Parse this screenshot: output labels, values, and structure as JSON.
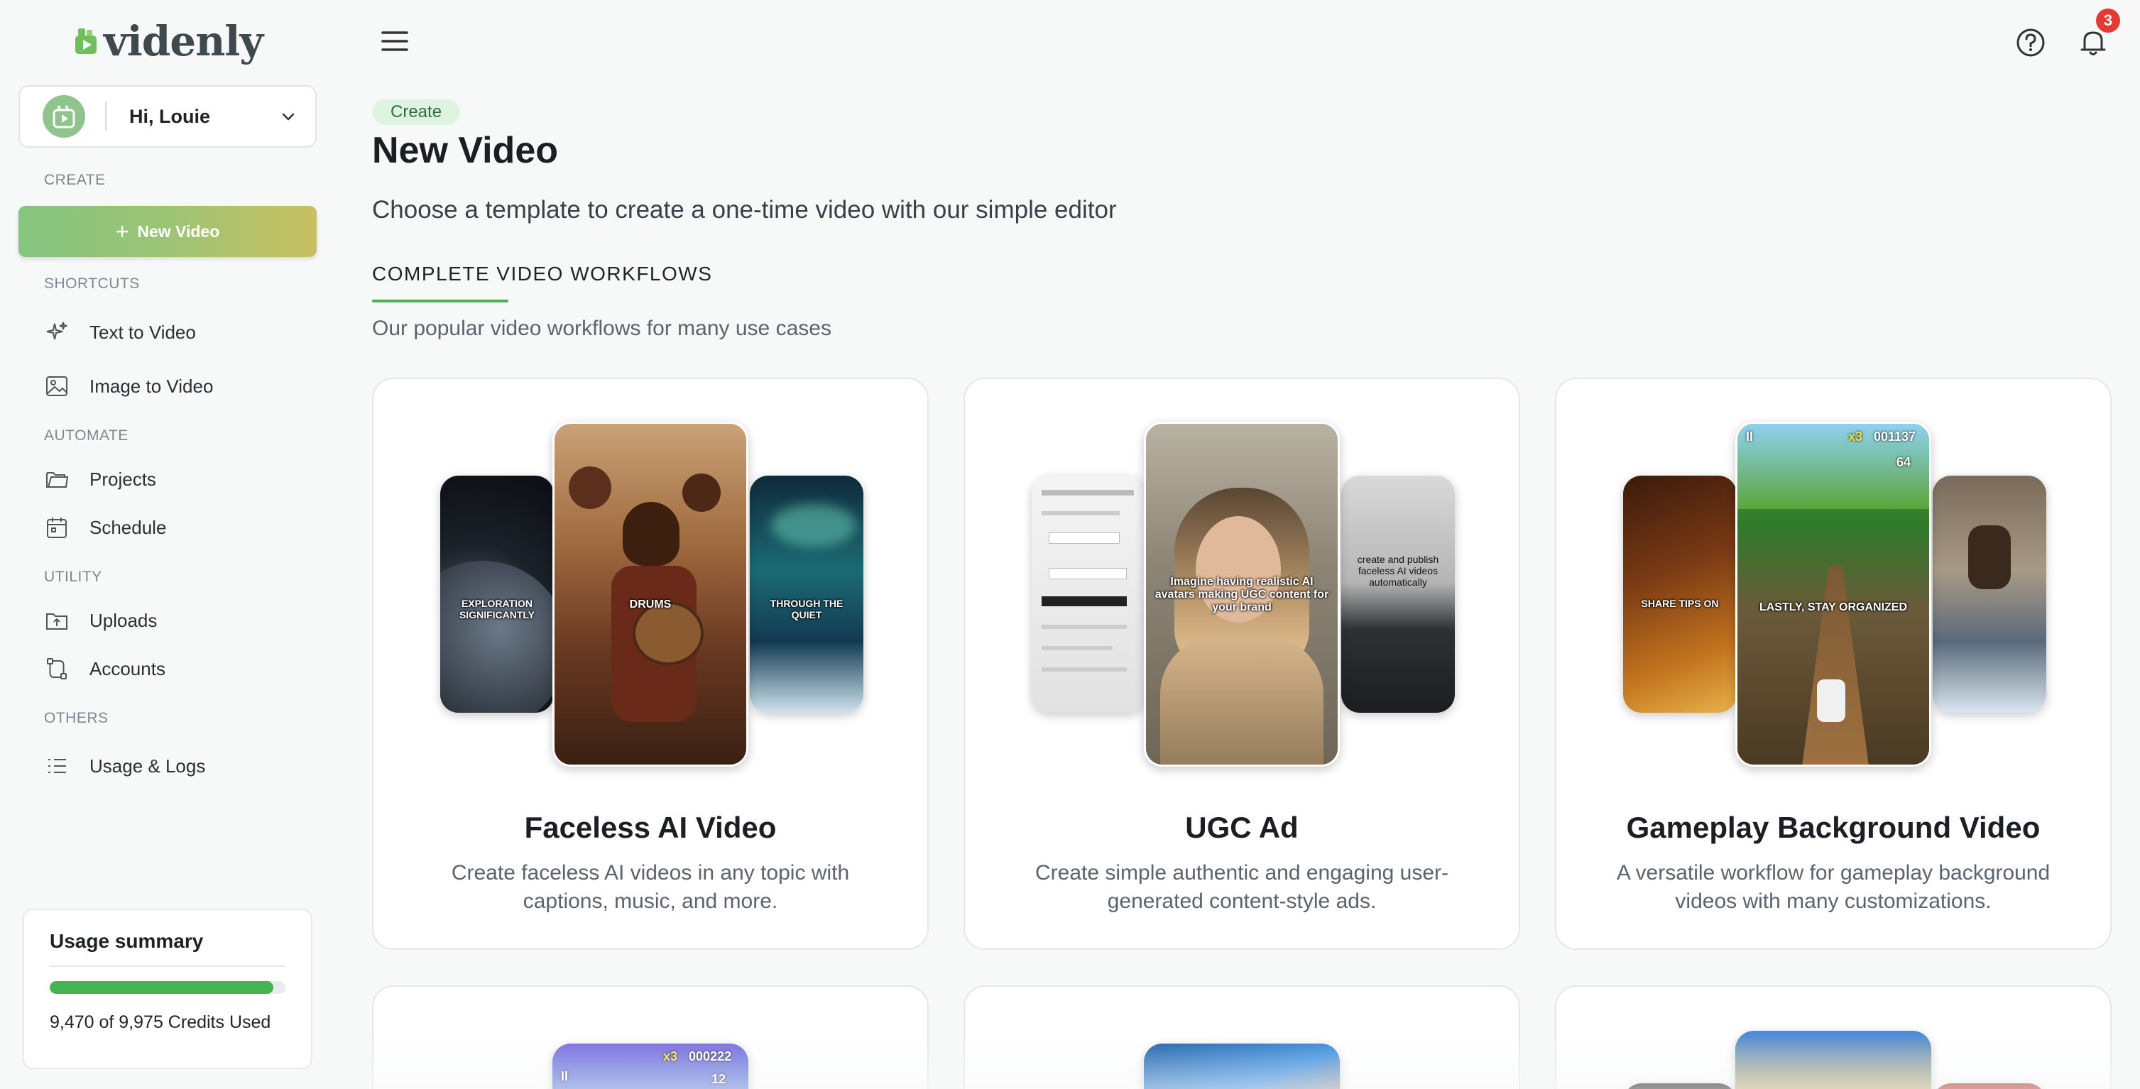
{
  "brand": {
    "name": "videnly",
    "accent": "#4cb05a"
  },
  "user": {
    "greeting": "Hi, Louie"
  },
  "sidebar": {
    "sections": {
      "create": "CREATE",
      "shortcuts": "SHORTCUTS",
      "automate": "AUTOMATE",
      "utility": "UTILITY",
      "others": "OTHERS"
    },
    "new_video_label": "New Video",
    "items": [
      {
        "label": "Text to Video",
        "icon": "sparkle-icon"
      },
      {
        "label": "Image to Video",
        "icon": "image-icon"
      },
      {
        "label": "Projects",
        "icon": "folder-icon"
      },
      {
        "label": "Schedule",
        "icon": "calendar-icon"
      },
      {
        "label": "Uploads",
        "icon": "upload-icon"
      },
      {
        "label": "Accounts",
        "icon": "accounts-icon"
      },
      {
        "label": "Usage & Logs",
        "icon": "list-icon"
      }
    ]
  },
  "usage": {
    "title": "Usage summary",
    "credits_text": "9,470 of 9,975 Credits Used",
    "used": 9470,
    "total": 9975
  },
  "header": {
    "notification_count": "3"
  },
  "main": {
    "breadcrumb": "Create",
    "title": "New Video",
    "subtitle": "Choose a template to create a one-time video with our simple editor",
    "section_title": "COMPLETE VIDEO WORKFLOWS",
    "section_subtitle": "Our popular video workflows for many use cases",
    "cards": [
      {
        "title": "Faceless AI Video",
        "description": "Create faceless AI videos in any topic with captions, music, and more.",
        "captions": {
          "left": "EXPLORATION SIGNIFICANTLY",
          "center": "DRUMS",
          "right": "THROUGH THE QUIET"
        }
      },
      {
        "title": "UGC Ad",
        "description": "Create simple authentic and engaging user-generated content-style ads.",
        "captions": {
          "center": "Imagine having realistic AI avatars making UGC content for your brand",
          "right": "create and publish faceless AI videos automatically"
        }
      },
      {
        "title": "Gameplay Background Video",
        "description": "A versatile workflow for gameplay background videos with many customizations.",
        "captions": {
          "left": "SHARE TIPS ON",
          "center": "LASTLY, STAY ORGANIZED"
        },
        "hud": {
          "multiplier": "x3",
          "score": "001137",
          "coins": "64"
        }
      }
    ],
    "row2_hud": {
      "multiplier": "x3",
      "score": "000222",
      "coins": "12"
    }
  }
}
